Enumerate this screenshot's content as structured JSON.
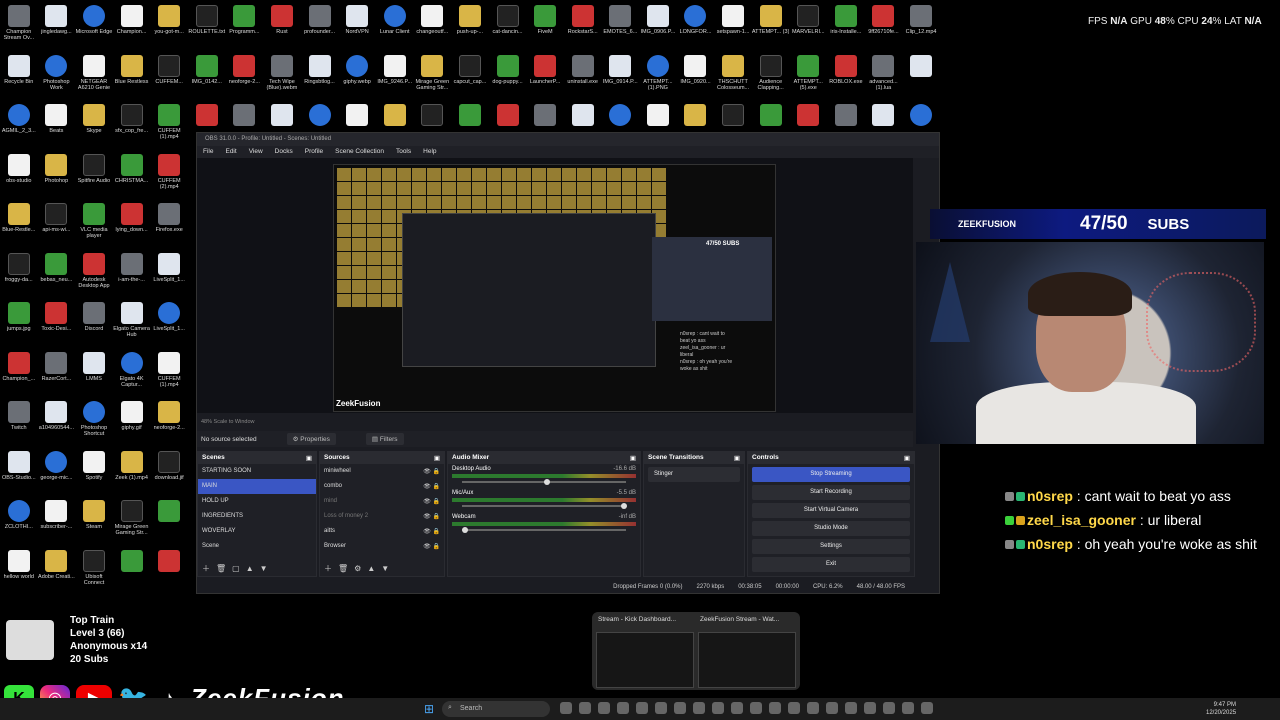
{
  "desktop": {
    "icons": [
      "Champion Stream Ov...",
      "jingledawg...",
      "Microsoft Edge",
      "Champion...",
      "you-got-m...",
      "ROULETTE.txt",
      "Programm...",
      "Rust",
      "profounder...",
      "NordVPN",
      "Lunar Client",
      "changeoutf...",
      "push-up-...",
      "cat-dancin...",
      "FiveM",
      "RockstarS...",
      "EMOTES_6...",
      "IMG_0906.P...",
      "LONGFOR...",
      "setspawn-1...",
      "ATTEMPT... (3)",
      "MARVELRI...",
      "iris-Installe...",
      "9ff26710fe...",
      "Clip_12.mp4",
      "Recycle Bin",
      "Photoshop Work",
      "NETGEAR A6210 Genie",
      "Blue Restless",
      "CUFFEM...",
      "IMG_0142...",
      "neoforge-2...",
      "Tech Wipe (Blue).webm",
      "Ringsbtlog...",
      "giphy.webp",
      "IMG_9246.P...",
      "Mirage Green Gaming Str...",
      "capcut_cap...",
      "dog-puppy...",
      "LauncherP...",
      "uninstall.exe",
      "IMG_0914.P...",
      "ATTEMPT... (1).PNG",
      "IMG_0920...",
      "THSCHUTT Colosseum...",
      "Audience Clapping...",
      "ATTEMPT... (5).exe",
      "ROBLOX.exe",
      "advanced... (1).lua",
      "",
      "AGMIL_2_3...",
      "Beats",
      "Skype",
      "sfx_cop_fre...",
      "CUFFEM (1).mp4",
      "",
      "",
      "",
      "",
      "",
      "",
      "",
      "",
      "",
      "",
      "",
      "",
      "",
      "",
      "",
      "",
      "",
      "",
      "",
      "",
      "obs-studio",
      "Photohop",
      "Spitfire Audio",
      "CHRISTMA...",
      "CUFFEM (2).mp4",
      "",
      "",
      "",
      "",
      "",
      "",
      "",
      "",
      "",
      "",
      "",
      "",
      "",
      "",
      "",
      "",
      "",
      "",
      "",
      "",
      "Blue-Restle...",
      "api-ms-wi...",
      "VLC media player",
      "lying_down...",
      "Firefox.exe",
      "",
      "",
      "",
      "",
      "",
      "",
      "",
      "",
      "",
      "",
      "",
      "",
      "",
      "",
      "",
      "",
      "",
      "",
      "",
      "",
      "froggy-da...",
      "bebas_neu...",
      "Autodesk Desktop App",
      "i-am-the-...",
      "LiveSplit_1...",
      "",
      "",
      "",
      "",
      "",
      "",
      "",
      "",
      "",
      "",
      "",
      "",
      "",
      "",
      "",
      "",
      "",
      "",
      "",
      "",
      "jumps.jpg",
      "Toxic-Desi...",
      "Discord",
      "Elgato Camera Hub",
      "LiveSplit_1...",
      "",
      "",
      "",
      "",
      "",
      "",
      "",
      "",
      "",
      "",
      "",
      "",
      "",
      "",
      "",
      "",
      "",
      "",
      "",
      "",
      "Champion_...",
      "RazerCort...",
      "LMMS",
      "Elgato 4K Captur...",
      "CUFFEM (1).mp4",
      "",
      "",
      "",
      "",
      "",
      "",
      "",
      "",
      "",
      "",
      "",
      "",
      "",
      "",
      "",
      "",
      "",
      "",
      "",
      "",
      "Twitch",
      "a104960544...",
      "Photoshop Shortcut",
      "giphy.gif",
      "neoforge-2...",
      "",
      "",
      "",
      "",
      "",
      "",
      "",
      "",
      "",
      "",
      "",
      "",
      "",
      "",
      "",
      "",
      "",
      "",
      "",
      "",
      "OBS-Studio...",
      "george-mic...",
      "Spotify",
      "Zeek (1).mp4",
      "download.jif",
      "",
      "",
      "",
      "",
      "",
      "",
      "",
      "",
      "",
      "",
      "",
      "",
      "",
      "",
      "",
      "",
      "",
      "",
      "",
      "",
      "ZCLOTHI...",
      "subscriber-...",
      "Steam",
      "Mirage Green Gaming Str...",
      "",
      "",
      "",
      "",
      "",
      "",
      "",
      "",
      "",
      "",
      "",
      "",
      "",
      "",
      "",
      "",
      "",
      "",
      "",
      "",
      "",
      "hellow world",
      "Adobe Creati...",
      "Ubisoft Connect",
      "",
      "",
      "",
      "",
      "",
      "",
      "",
      "",
      "",
      "",
      "",
      "",
      "",
      "",
      "",
      "",
      "",
      "",
      "",
      "",
      "",
      ""
    ]
  },
  "stats": {
    "fps_label": "FPS",
    "fps": "N/A",
    "gpu_label": "GPU",
    "gpu": "48",
    "cpu_label": "CPU",
    "cpu": "24",
    "lat_label": "LAT",
    "lat": "N/A",
    "pct": "%"
  },
  "subgoal": {
    "brand": "ZEEKFUSION",
    "count": "47/50",
    "label": "SUBS"
  },
  "chat": [
    {
      "user": "n0srep",
      "sep": " : ",
      "text": "cant wait to beat yo ass"
    },
    {
      "user": "zeel_isa_gooner",
      "sep": " : ",
      "text": "ur liberal"
    },
    {
      "user": "n0srep",
      "sep": " : ",
      "text": "oh yeah you're woke as shit"
    }
  ],
  "train": {
    "title": "Top Train",
    "level": "Level 3",
    "level_count": "(66)",
    "anon": "Anonymous x14",
    "subs": "20 Subs"
  },
  "socials": {
    "name": "ZeekFusion"
  },
  "obs": {
    "title": "OBS 31.0.0 - Profile: Untitled - Scenes: Untitled",
    "menu": [
      "File",
      "Edit",
      "View",
      "Docks",
      "Profile",
      "Scene Collection",
      "Tools",
      "Help"
    ],
    "zoom": "48%   Scale to Window",
    "no_source": "No source selected",
    "properties": "Properties",
    "filters": "Filters",
    "preview_brand": "ZeekFusion",
    "preview_sub": "47/50  SUBS",
    "preview_chat": [
      "n0srep : cant wait to",
      "beat yo ass",
      "zeel_isa_gooner : ur",
      "liberal",
      "n0srep : oh yeah you're",
      "woke as shit"
    ],
    "scenes_title": "Scenes",
    "scenes": [
      "STARTING SOON",
      "MAIN",
      "HOLD UP",
      "INGREDIENTS",
      "WOVERLAY",
      "Scene"
    ],
    "sources_title": "Sources",
    "sources": [
      "miniwheel",
      "combo",
      "mind",
      "Loss of money 2",
      "aitts",
      "Browser"
    ],
    "mixer_title": "Audio Mixer",
    "mixer": [
      {
        "name": "Desktop Audio",
        "db": "-16.6 dB"
      },
      {
        "name": "Mic/Aux",
        "db": "-5.5 dB"
      },
      {
        "name": "Webcam",
        "db": "-inf dB"
      }
    ],
    "transitions_title": "Scene Transitions",
    "transition": "Stinger",
    "controls_title": "Controls",
    "controls": [
      "Stop Streaming",
      "Start Recording",
      "Start Virtual Camera",
      "Studio Mode",
      "Settings",
      "Exit"
    ],
    "status": {
      "dropped": "Dropped Frames 0 (0.0%)",
      "kbps": "2270 kbps",
      "live": "00:38:05",
      "rec": "00:00:00",
      "cpu": "CPU: 6.2%",
      "fps": "48.00 / 48.00 FPS"
    }
  },
  "thumbs": [
    "Stream - Kick Dashboard...",
    "ZeekFusion Stream - Wat..."
  ],
  "taskbar": {
    "search": "Search",
    "time": "9:47 PM",
    "date": "12/20/2025"
  },
  "colors": {
    "accent": "#3a56c4",
    "chat_user": "#ffd84a",
    "sub_bar": "#0d1a80",
    "kick": "#35e33b"
  }
}
